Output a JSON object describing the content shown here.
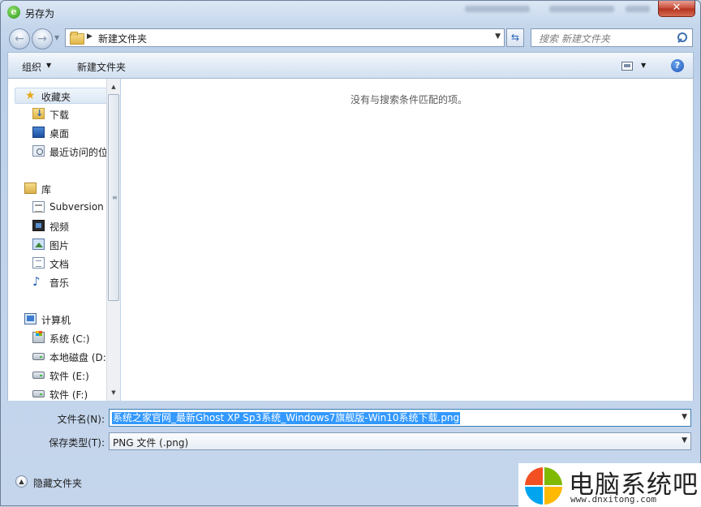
{
  "window": {
    "title": "另存为",
    "close_glyph": "✕"
  },
  "address": {
    "path": "新建文件夹"
  },
  "search": {
    "placeholder": "搜索 新建文件夹"
  },
  "toolbar": {
    "organize": "组织",
    "new_folder": "新建文件夹",
    "help": "?"
  },
  "sidebar": {
    "items": [
      {
        "label": "收藏夹",
        "icon": "star-icon"
      },
      {
        "label": "下载",
        "icon": "downloads-folder-icon"
      },
      {
        "label": "桌面",
        "icon": "desktop-icon"
      },
      {
        "label": "最近访问的位",
        "icon": "recent-places-icon"
      },
      {
        "label": "库",
        "icon": "library-icon"
      },
      {
        "label": "Subversion",
        "icon": "subversion-icon"
      },
      {
        "label": "视频",
        "icon": "video-icon"
      },
      {
        "label": "图片",
        "icon": "pictures-icon"
      },
      {
        "label": "文档",
        "icon": "documents-icon"
      },
      {
        "label": "音乐",
        "icon": "music-icon"
      },
      {
        "label": "计算机",
        "icon": "computer-icon"
      },
      {
        "label": "系统 (C:)",
        "icon": "system-drive-icon"
      },
      {
        "label": "本地磁盘 (D:)",
        "icon": "drive-icon"
      },
      {
        "label": "软件 (E:)",
        "icon": "drive-icon"
      },
      {
        "label": "软件 (F:)",
        "icon": "drive-icon"
      }
    ]
  },
  "content": {
    "empty_message": "没有与搜索条件匹配的项。"
  },
  "fields": {
    "filename_label": "文件名(N):",
    "filename_value": "系统之家官网_最新Ghost XP Sp3系统_Windows7旗舰版-Win10系统下载.png",
    "filetype_label": "保存类型(T):",
    "filetype_value": "PNG 文件 (.png)"
  },
  "footer": {
    "hide_folders": "隐藏文件夹"
  },
  "watermark": {
    "brand": "电脑系统吧",
    "url": "www.dnxitong.com"
  },
  "colors": {
    "accent": "#3399ff",
    "close": "#c74a36"
  }
}
